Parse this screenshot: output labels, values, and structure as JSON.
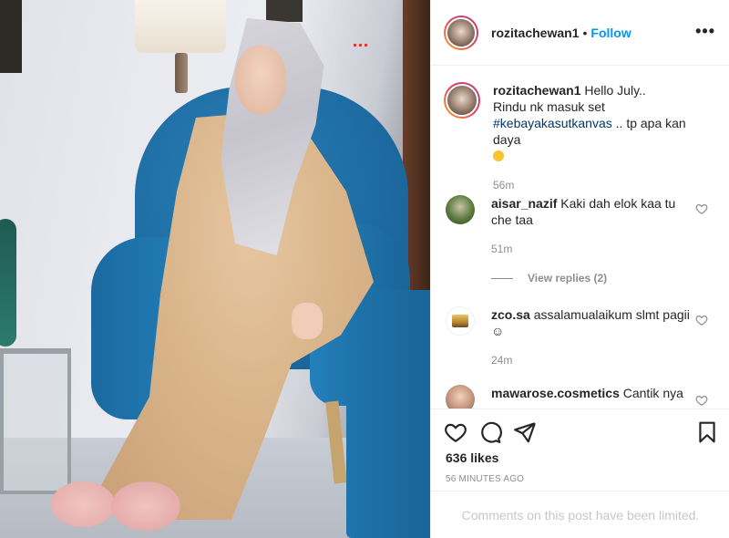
{
  "header": {
    "username": "rozitachewan1",
    "separator": "•",
    "follow_label": "Follow",
    "more_label": "•••"
  },
  "caption": {
    "username": "rozitachewan1",
    "line1": "Hello July..",
    "line2": "Rindu nk masuk set",
    "hashtag": "#kebayakasutkanvas",
    "line3_rest": " .. tp apa kan daya",
    "time": "56m"
  },
  "comments": [
    {
      "username": "aisar_nazif",
      "text": "Kaki dah elok kaa tu che taa",
      "time": "51m",
      "view_replies": "View replies (2)"
    },
    {
      "username": "zco.sa",
      "text": "assalamualaikum slmt pagii",
      "emoji": "☺",
      "time": "24m"
    },
    {
      "username": "mawarose.cosmetics",
      "text": "Cantik nya"
    }
  ],
  "actions": {
    "likes": "636 likes",
    "posted_ago": "56 MINUTES AGO",
    "icons": [
      "heart-icon",
      "comment-icon",
      "share-icon",
      "bookmark-icon"
    ]
  },
  "footer": {
    "limited_text": "Comments on this post have been limited."
  },
  "colors": {
    "link_blue": "#0095f6",
    "hashtag_blue": "#00376b",
    "muted": "#8e8e8e",
    "chair_blue": "#1f6ea6"
  }
}
